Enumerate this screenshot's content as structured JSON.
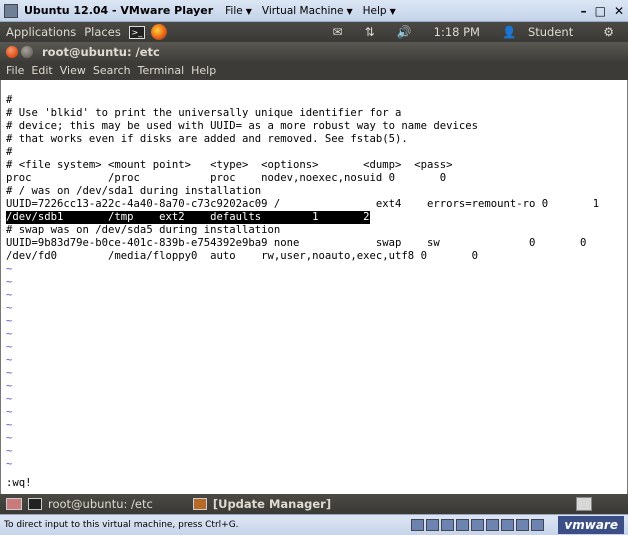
{
  "vmware": {
    "title": "Ubuntu 12.04 - VMware Player",
    "menus": [
      {
        "label": "File"
      },
      {
        "label": "Virtual Machine"
      },
      {
        "label": "Help"
      }
    ],
    "status_text": "To direct input to this virtual machine, press Ctrl+G.",
    "logo_text": "vmware"
  },
  "panel": {
    "applications": "Applications",
    "places": "Places",
    "time": "1:18 PM",
    "user": "Student"
  },
  "terminal": {
    "title": "root@ubuntu: /etc",
    "menus": [
      "File",
      "Edit",
      "View",
      "Search",
      "Terminal",
      "Help"
    ],
    "lines": [
      {
        "text": "#"
      },
      {
        "text": "# Use 'blkid' to print the universally unique identifier for a"
      },
      {
        "text": "# device; this may be used with UUID= as a more robust way to name devices"
      },
      {
        "text": "# that works even if disks are added and removed. See fstab(5)."
      },
      {
        "text": "#"
      },
      {
        "text": "# <file system> <mount point>   <type>  <options>       <dump>  <pass>"
      },
      {
        "text": "proc            /proc           proc    nodev,noexec,nosuid 0       0"
      },
      {
        "text": "# / was on /dev/sda1 during installation"
      },
      {
        "text": "UUID=7226cc13-a22c-4a40-8a70-c73c9202ac09 /               ext4    errors=remount-ro 0       1"
      },
      {
        "text": "/dev/sdb1       /tmp    ext2    defaults        1       2"
      },
      {
        "text": "# swap was on /dev/sda5 during installation"
      },
      {
        "text": "UUID=9b83d79e-b0ce-401c-839b-e754392e9ba9 none            swap    sw              0       0"
      },
      {
        "text": "/dev/fd0        /media/floppy0  auto    rw,user,noauto,exec,utf8 0       0"
      }
    ],
    "tilde": "~",
    "command": ":wq!"
  },
  "taskbar": {
    "items": [
      {
        "label": "root@ubuntu: /etc"
      },
      {
        "label": "[Update Manager]"
      }
    ]
  }
}
